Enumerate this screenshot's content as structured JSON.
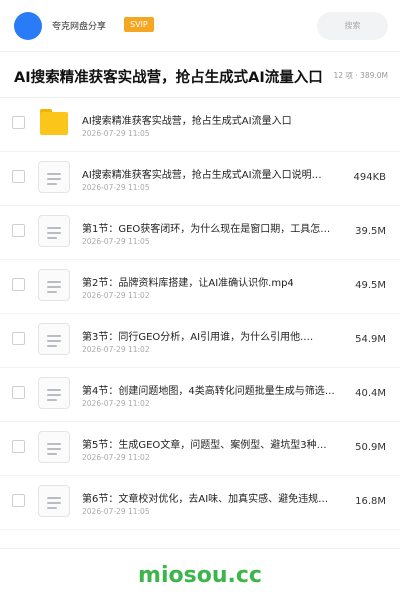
{
  "header": {
    "app_name": "夸克网盘分享",
    "badge": "SVIP",
    "search_placeholder": "搜索",
    "avatar_color": "#2a7cf6"
  },
  "folder": {
    "title": "AI搜索精准获客实战营，抢占生成式AI流量入口",
    "meta": "12 项 · 389.0M"
  },
  "files": [
    {
      "type": "folder",
      "name": "AI搜索精准获客实战营，抢占生成式AI流量入口",
      "date": "2026-07-29 11:05",
      "size": ""
    },
    {
      "type": "doc",
      "name": "AI搜索精准获客实战营，抢占生成式AI流量入口说明…",
      "date": "2026-07-29 11:05",
      "size": "494KB"
    },
    {
      "type": "doc",
      "name": "第1节：GEO获客闭环，为什么现在是窗口期，工具怎…",
      "date": "2026-07-29 11:05",
      "size": "39.5M"
    },
    {
      "type": "doc",
      "name": "第2节：品牌资料库搭建，让AI准确认识你.mp4",
      "date": "2026-07-29 11:02",
      "size": "49.5M"
    },
    {
      "type": "doc",
      "name": "第3节：同行GEO分析，AI引用谁，为什么引用他.…",
      "date": "2026-07-29 11:02",
      "size": "54.9M"
    },
    {
      "type": "doc",
      "name": "第4节：创建问题地图，4类高转化问题批量生成与筛选…",
      "date": "2026-07-29 11:02",
      "size": "40.4M"
    },
    {
      "type": "doc",
      "name": "第5节：生成GEO文章，问题型、案例型、避坑型3种…",
      "date": "2026-07-29 11:02",
      "size": "50.9M"
    },
    {
      "type": "doc",
      "name": "第6节：文章校对优化，去AI味、加真实感、避免违规…",
      "date": "2026-07-29 11:05",
      "size": "16.8M"
    }
  ],
  "watermark": "miosou.cc",
  "colors": {
    "accent": "#2a7cf6",
    "svip": "#f5a623",
    "folder": "#fcc51a",
    "watermark": "#3cb54a"
  }
}
